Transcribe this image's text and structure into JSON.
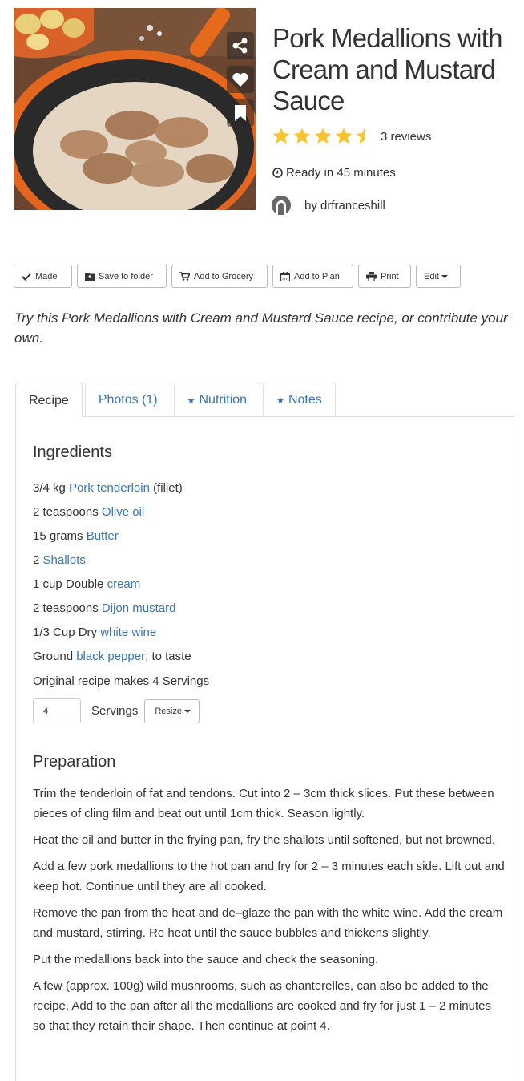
{
  "recipe": {
    "title": "Pork Medallions with Cream and Mustard Sauce",
    "rating": 4.5,
    "reviews_text": "3 reviews",
    "ready_text": "Ready in 45 minutes",
    "author_text": "by drfranceshill"
  },
  "toolbar": {
    "made": "Made",
    "save": "Save to folder",
    "grocery": "Add to Grocery",
    "plan": "Add to Plan",
    "print": "Print",
    "edit": "Edit"
  },
  "intro": "Try this Pork Medallions with Cream and Mustard Sauce recipe, or contribute your own.",
  "tabs": {
    "recipe": "Recipe",
    "photos": "Photos (1)",
    "nutrition": "Nutrition",
    "notes": "Notes"
  },
  "ingredients": {
    "heading": "Ingredients",
    "items": [
      {
        "pre": "3/4 kg ",
        "link": "Pork tenderloin",
        "post": " (fillet)"
      },
      {
        "pre": "2 teaspoons ",
        "link": "Olive oil",
        "post": ""
      },
      {
        "pre": "15 grams ",
        "link": "Butter",
        "post": ""
      },
      {
        "pre": "2 ",
        "link": "Shallots",
        "post": ""
      },
      {
        "pre": "1 cup Double ",
        "link": "cream",
        "post": ""
      },
      {
        "pre": "2 teaspoons ",
        "link": "Dijon mustard",
        "post": ""
      },
      {
        "pre": "1/3 Cup Dry ",
        "link": "white wine",
        "post": ""
      },
      {
        "pre": "Ground ",
        "link": "black pepper",
        "post": "; to taste"
      }
    ],
    "makes_text": "Original recipe makes 4 Servings",
    "servings_value": "4",
    "servings_label": "Servings",
    "resize_label": "Resize"
  },
  "preparation": {
    "heading": "Preparation",
    "steps": [
      "Trim the tenderloin of fat and tendons. Cut into 2 – 3cm thick slices. Put these between pieces of cling film and beat out until 1cm thick. Season lightly.",
      "Heat the oil and butter in the frying pan, fry the shallots until softened, but not browned.",
      "Add a few pork medallions to the hot pan and fry for 2 – 3 minutes each side. Lift out and keep hot. Continue until they are all cooked.",
      "Remove the pan from the heat and de–glaze the pan with the white wine. Add the cream and mustard, stirring. Re heat until the sauce bubbles and thickens slightly.",
      "Put the medallions back into the sauce and check the seasoning.",
      "A few (approx. 100g) wild mushrooms, such as chanterelles, can also be added to the recipe. Add to the pan after all the medallions are cooked and fry for just 1 – 2 minutes so that they retain their shape. Then continue at point 4."
    ]
  },
  "colors": {
    "link": "#3a74ad",
    "star": "#f7c531",
    "text": "#333333"
  },
  "icons": [
    "share-icon",
    "heart-icon",
    "bookmark-icon",
    "star-icon",
    "clock-icon",
    "avatar-icon",
    "check-icon",
    "folder-icon",
    "cart-icon",
    "calendar-icon",
    "printer-icon"
  ]
}
